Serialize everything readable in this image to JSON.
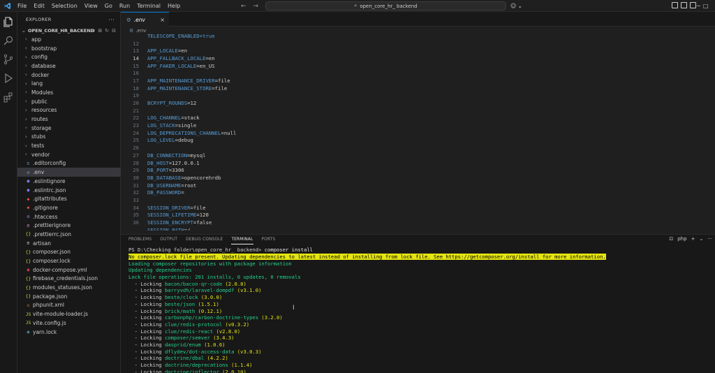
{
  "menu": [
    "File",
    "Edit",
    "Selection",
    "View",
    "Go",
    "Run",
    "Terminal",
    "Help"
  ],
  "search": {
    "text": "open_core_hr_ backend"
  },
  "colors": {
    "accent": "#0078d4",
    "key": "#569cd6",
    "terminal_green": "#23d18b",
    "terminal_yellow": "#e5e510"
  },
  "sidebar": {
    "title": "EXPLORER",
    "root": "OPEN_CORE_HR_BACKEND",
    "items": [
      {
        "label": "app",
        "type": "folder"
      },
      {
        "label": "bootstrap",
        "type": "folder"
      },
      {
        "label": "config",
        "type": "folder"
      },
      {
        "label": "database",
        "type": "folder"
      },
      {
        "label": "docker",
        "type": "folder"
      },
      {
        "label": "lang",
        "type": "folder"
      },
      {
        "label": "Modules",
        "type": "folder"
      },
      {
        "label": "public",
        "type": "folder"
      },
      {
        "label": "resources",
        "type": "folder"
      },
      {
        "label": "routes",
        "type": "folder"
      },
      {
        "label": "storage",
        "type": "folder"
      },
      {
        "label": "stubs",
        "type": "folder"
      },
      {
        "label": "tests",
        "type": "folder"
      },
      {
        "label": "vendor",
        "type": "folder"
      },
      {
        "label": ".editorconfig",
        "type": "gear",
        "icon": "≡"
      },
      {
        "label": ".env",
        "type": "gear",
        "icon": "⚙",
        "selected": true
      },
      {
        "label": ".eslintignore",
        "type": "eslint",
        "icon": "●"
      },
      {
        "label": ".eslintrc.json",
        "type": "eslint",
        "icon": "●"
      },
      {
        "label": ".gitattributes",
        "type": "git",
        "icon": "◆"
      },
      {
        "label": ".gitignore",
        "type": "git",
        "icon": "◆"
      },
      {
        "label": ".htaccess",
        "type": "gear",
        "icon": "⚙"
      },
      {
        "label": ".prettierignore",
        "type": "prettier",
        "icon": "≡"
      },
      {
        "label": ".prettierrc.json",
        "type": "json",
        "icon": "{}"
      },
      {
        "label": "artisan",
        "type": "plain",
        "icon": "≡"
      },
      {
        "label": "composer.json",
        "type": "json",
        "icon": "{}"
      },
      {
        "label": "composer.lock",
        "type": "lock",
        "icon": "{}"
      },
      {
        "label": "docker-compose.yml",
        "type": "docker",
        "icon": "◉"
      },
      {
        "label": "firebase_credentials.json",
        "type": "json",
        "icon": "{}"
      },
      {
        "label": "modules_statuses.json",
        "type": "json",
        "icon": "{}"
      },
      {
        "label": "package.json",
        "type": "json",
        "icon": "{}"
      },
      {
        "label": "phpunit.xml",
        "type": "xml",
        "icon": "◇"
      },
      {
        "label": "vite-module-loader.js",
        "type": "js",
        "icon": "JS"
      },
      {
        "label": "vite.config.js",
        "type": "js",
        "icon": "JS"
      },
      {
        "label": "yarn.lock",
        "type": "yarn",
        "icon": "◉"
      }
    ]
  },
  "editor": {
    "tab": ".env",
    "breadcrumb": ".env",
    "lines": [
      {
        "n": "",
        "k": "TELESCOPE_ENABLED=true",
        "v": ""
      },
      {
        "n": "12",
        "k": "",
        "v": ""
      },
      {
        "n": "13",
        "k": "APP_LOCALE",
        "v": "=en"
      },
      {
        "n": "14",
        "k": "APP_FALLBACK_LOCALE",
        "v": "=en",
        "current": true
      },
      {
        "n": "15",
        "k": "APP_FAKER_LOCALE",
        "v": "=en_US"
      },
      {
        "n": "16",
        "k": "",
        "v": ""
      },
      {
        "n": "17",
        "k": "APP_MAINTENANCE_DRIVER",
        "v": "=file"
      },
      {
        "n": "18",
        "k": "APP_MAINTENANCE_STORE",
        "v": "=file"
      },
      {
        "n": "19",
        "k": "",
        "v": ""
      },
      {
        "n": "20",
        "k": "BCRYPT_ROUNDS",
        "v": "=12"
      },
      {
        "n": "21",
        "k": "",
        "v": ""
      },
      {
        "n": "22",
        "k": "LOG_CHANNEL",
        "v": "=stack"
      },
      {
        "n": "23",
        "k": "LOG_STACK",
        "v": "=single"
      },
      {
        "n": "24",
        "k": "LOG_DEPRECATIONS_CHANNEL",
        "v": "=null"
      },
      {
        "n": "25",
        "k": "LOG_LEVEL",
        "v": "=debug"
      },
      {
        "n": "26",
        "k": "",
        "v": ""
      },
      {
        "n": "27",
        "k": "DB_CONNECTION",
        "v": "=mysql"
      },
      {
        "n": "28",
        "k": "DB_HOST",
        "v": "=127.0.0.1"
      },
      {
        "n": "29",
        "k": "DB_PORT",
        "v": "=3306"
      },
      {
        "n": "30",
        "k": "DB_DATABASE",
        "v": "=opencorehrdb"
      },
      {
        "n": "31",
        "k": "DB_USERNAME",
        "v": "=root"
      },
      {
        "n": "32",
        "k": "DB_PASSWORD",
        "v": "="
      },
      {
        "n": "33",
        "k": "",
        "v": ""
      },
      {
        "n": "34",
        "k": "SESSION_DRIVER",
        "v": "=file"
      },
      {
        "n": "35",
        "k": "SESSION_LIFETIME",
        "v": "=120"
      },
      {
        "n": "36",
        "k": "SESSION_ENCRYPT",
        "v": "=false"
      },
      {
        "n": "",
        "k": "SESSION_PATH",
        "v": "=/"
      }
    ]
  },
  "panel": {
    "tabs": [
      {
        "label": "PROBLEMS",
        "active": false
      },
      {
        "label": "OUTPUT",
        "active": false
      },
      {
        "label": "DEBUG CONSOLE",
        "active": false
      },
      {
        "label": "TERMINAL",
        "active": true
      },
      {
        "label": "PORTS",
        "active": false
      }
    ],
    "shell": "php",
    "prompt": "PS D:\\Checking folder\\open_core_hr_ backend> ",
    "command": "composer install",
    "warning": "No composer.lock file present. Updating dependencies to latest instead of installing from lock file. See https://getcomposer.org/install for more information.",
    "info_lines": [
      "Loading composer repositories with package information",
      "Updating dependencies",
      "Lock file operations: 201 installs, 0 updates, 0 removals"
    ],
    "lock_prefix": "  - Locking ",
    "locks": [
      {
        "pkg": "bacon/bacon-qr-code",
        "ver": "(2.0.8)"
      },
      {
        "pkg": "barryvdh/laravel-dompdf",
        "ver": "(v3.1.0)"
      },
      {
        "pkg": "beste/clock",
        "ver": "(3.0.0)"
      },
      {
        "pkg": "beste/json",
        "ver": "(1.5.1)"
      },
      {
        "pkg": "brick/math",
        "ver": "(0.12.1)"
      },
      {
        "pkg": "carbonphp/carbon-doctrine-types",
        "ver": "(3.2.0)"
      },
      {
        "pkg": "clue/redis-protocol",
        "ver": "(v0.3.2)"
      },
      {
        "pkg": "clue/redis-react",
        "ver": "(v2.8.0)"
      },
      {
        "pkg": "composer/semver",
        "ver": "(3.4.3)"
      },
      {
        "pkg": "dasprid/enum",
        "ver": "(1.0.6)"
      },
      {
        "pkg": "dflydev/dot-access-data",
        "ver": "(v3.0.3)"
      },
      {
        "pkg": "doctrine/dbal",
        "ver": "(4.2.2)"
      },
      {
        "pkg": "doctrine/deprecations",
        "ver": "(1.1.4)"
      },
      {
        "pkg": "doctrine/inflector",
        "ver": "(2.0.10)"
      }
    ]
  }
}
